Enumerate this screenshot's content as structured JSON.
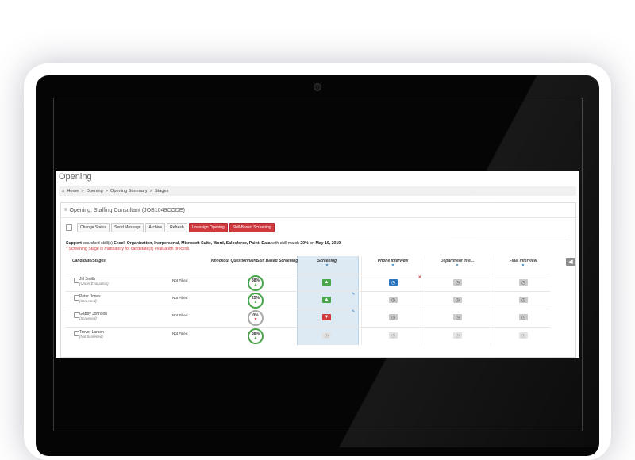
{
  "page": {
    "title": "Opening"
  },
  "breadcrumb": {
    "home": "Home",
    "opening": "Opening",
    "summary": "Opening Summary",
    "stages": "Stages",
    "sep": ">"
  },
  "panel": {
    "title": "Opening: Staffing Consultant (JOB1049CODE)"
  },
  "toolbar": {
    "change_status": "Change Status",
    "send_message": "Send Message",
    "archive": "Archive",
    "refresh": "Refresh",
    "unassign": "Unassign Opening",
    "skill_screening": "Skill-Based Screening"
  },
  "support": {
    "prefix": "Support",
    "middle": " searched skill(s) ",
    "skills": "Excel, Organization, Inerpersonal, Microsoft Suite, Word, Salesforce, Paint, Data",
    "match_text": " with skill match ",
    "percent": "20%",
    "on_text": " on ",
    "date": "May 19, 2019"
  },
  "note": "* Screening Stage is mandatory for candidate(s) evaluation process.",
  "columns": {
    "candidate": "Candidate/Stages",
    "knockout": "Knockout Questionnaire",
    "skill": "Skill Based Screening",
    "screening": "Screening",
    "phone": "Phone Interview",
    "department": "Department Inte...",
    "final": "Final Interview"
  },
  "candidates": [
    {
      "name": "Jill Smith",
      "status": "(Under Evaluation)",
      "knockout": "Not Filled",
      "score": "38%"
    },
    {
      "name": "Peter Jones",
      "status": "(Screened)",
      "knockout": "Not Filled",
      "score": "25%"
    },
    {
      "name": "Gabby Johnson",
      "status": "(Screened)",
      "knockout": "Not Filled",
      "score": "0%"
    },
    {
      "name": "Trevor Larson",
      "status": "(Not Screened)",
      "knockout": "Not Filled",
      "score": "38%"
    }
  ],
  "icons": {
    "home": "home-icon",
    "menu": "list-icon",
    "thumbs_up": "thumbs-up-icon",
    "thumbs_down": "thumbs-down-icon",
    "clock": "clock-icon",
    "funnel": "filter-icon",
    "pencil": "pencil-icon",
    "close": "close-icon",
    "arrow": "arrow-left-icon"
  },
  "colors": {
    "accent_red": "#d0393d",
    "success_green": "#4aa64a",
    "primary_blue": "#2a74c0",
    "screening_bg": "#ddeaf4"
  }
}
